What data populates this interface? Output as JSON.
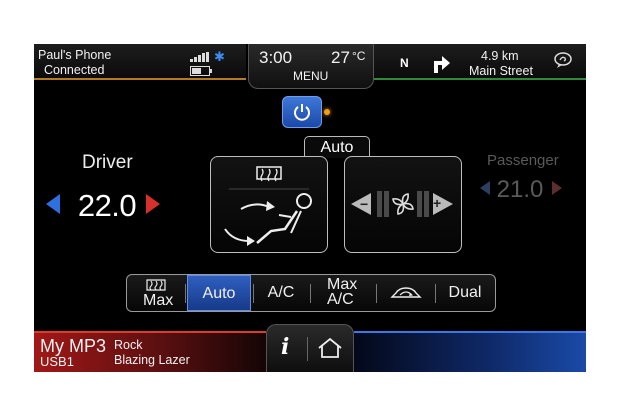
{
  "phone": {
    "name": "Paul's Phone",
    "status": "Connected"
  },
  "center": {
    "time": "3:00",
    "temperature": "27",
    "temp_unit": "°C",
    "menu_label": "MENU"
  },
  "nav": {
    "compass": "N",
    "distance": "4.9 km",
    "street": "Main Street"
  },
  "climate": {
    "auto_tab": "Auto",
    "driver": {
      "label": "Driver",
      "temp": "22.0"
    },
    "passenger": {
      "label": "Passenger",
      "temp": "21.0"
    }
  },
  "modes": [
    {
      "label": "Max",
      "icon": "rear-defrost-icon",
      "active": false
    },
    {
      "label": "Auto",
      "active": true
    },
    {
      "label": "A/C",
      "active": false
    },
    {
      "label_line1": "Max",
      "label_line2": "A/C",
      "active": false
    },
    {
      "icon": "recirculation-icon",
      "active": false
    },
    {
      "label": "Dual",
      "active": false
    }
  ],
  "media": {
    "source": "My MP3",
    "device": "USB1",
    "genre": "Rock",
    "title": "Blazing Lazer"
  },
  "colors": {
    "phone_accent": "#b77a1e",
    "nav_accent": "#2f8a3c",
    "active_blue": "#2f5fc0",
    "media_red": "#a11817",
    "climate_blue": "#1a4aa8"
  }
}
